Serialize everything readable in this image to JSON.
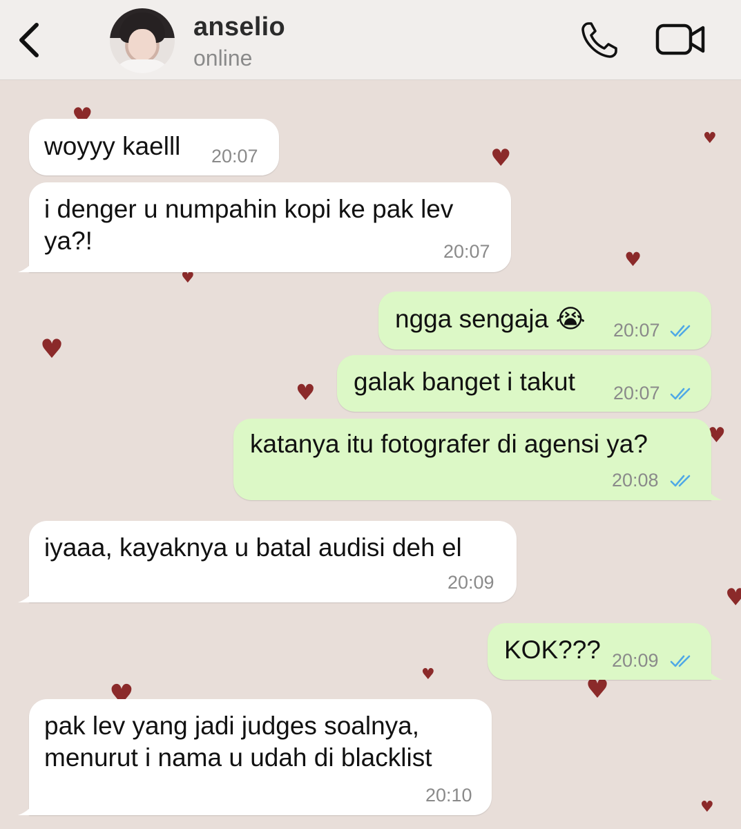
{
  "header": {
    "name": "anselio",
    "status": "online"
  },
  "messages": [
    {
      "direction": "incoming",
      "text": "woyyy kaelll",
      "time": "20:07"
    },
    {
      "direction": "incoming",
      "text_line1": "i denger u numpahin kopi ke pak lev",
      "text_line2": "ya?!",
      "time": "20:07"
    },
    {
      "direction": "outgoing",
      "text": "ngga sengaja 😭",
      "time": "20:07",
      "read": true
    },
    {
      "direction": "outgoing",
      "text": "galak banget i takut",
      "time": "20:07",
      "read": true
    },
    {
      "direction": "outgoing",
      "text": "katanya itu fotografer di agensi ya?",
      "time": "20:08",
      "read": true
    },
    {
      "direction": "incoming",
      "text": "iyaaa, kayaknya u batal audisi deh el",
      "time": "20:09"
    },
    {
      "direction": "outgoing",
      "text": "KOK???",
      "time": "20:09",
      "read": true
    },
    {
      "direction": "incoming",
      "text_line1": "pak lev yang jadi judges soalnya,",
      "text_line2": "menurut i nama u udah di blacklist",
      "time": "20:10"
    }
  ],
  "colors": {
    "incoming_bubble": "#ffffff",
    "outgoing_bubble": "#dcf8c6",
    "read_ticks": "#4fa8e6",
    "wallpaper": "#e8ded9",
    "heart": "#8b2a2a"
  },
  "icons": {
    "back": "chevron-left-icon",
    "call": "phone-icon",
    "video": "video-camera-icon",
    "read": "double-check-icon",
    "wallpaper": "heart-icon"
  }
}
